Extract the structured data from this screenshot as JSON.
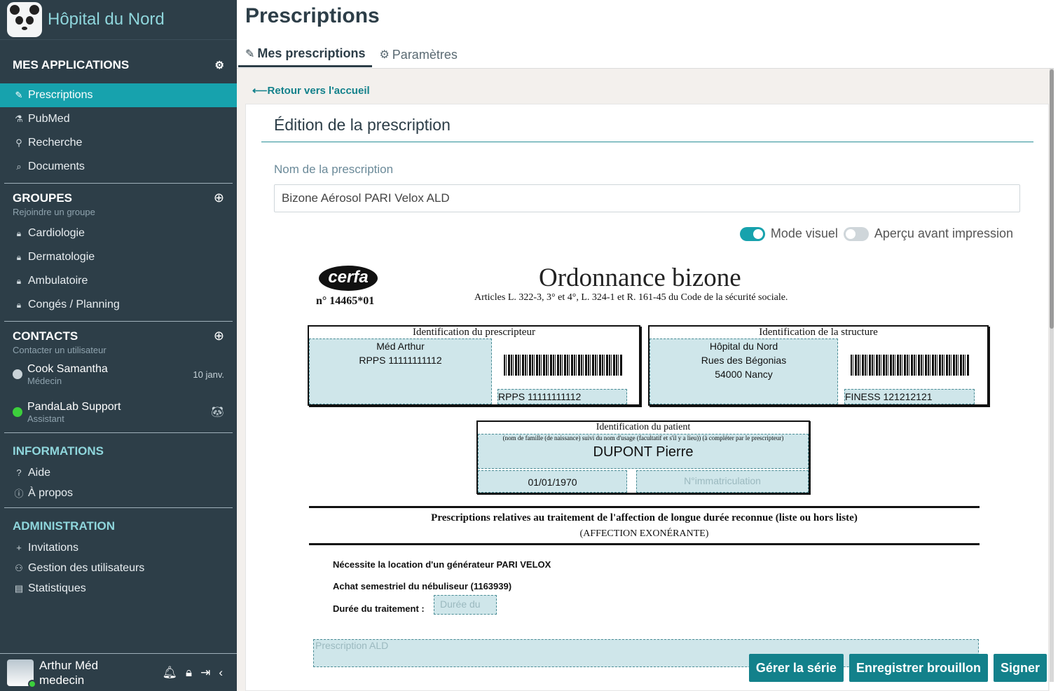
{
  "app": {
    "name": "Hôpital du Nord"
  },
  "sidebar": {
    "apps_header": "MES APPLICATIONS",
    "apps": [
      {
        "label": "Prescriptions",
        "icon": "prescription-icon",
        "glyph": "✎",
        "active": true
      },
      {
        "label": "PubMed",
        "icon": "pubmed-icon",
        "glyph": "⚗",
        "active": false
      },
      {
        "label": "Recherche",
        "icon": "search-icon",
        "glyph": "⚲",
        "active": false
      },
      {
        "label": "Documents",
        "icon": "paperclip-icon",
        "glyph": "⌕",
        "active": false
      }
    ],
    "groups_header": "GROUPES",
    "groups_sub": "Rejoindre un groupe",
    "groups": [
      {
        "label": "Cardiologie"
      },
      {
        "label": "Dermatologie"
      },
      {
        "label": "Ambulatoire"
      },
      {
        "label": "Congés / Planning"
      }
    ],
    "contacts_header": "CONTACTS",
    "contacts_sub": "Contacter un utilisateur",
    "contacts": [
      {
        "name": "Cook Samantha",
        "role": "Médecin",
        "meta": "10 janv.",
        "status_color": "#c9d3d8"
      },
      {
        "name": "PandaLab Support",
        "role": "Assistant",
        "meta": "",
        "status_color": "#3ccf3c"
      }
    ],
    "info_header": "INFORMATIONS",
    "info": [
      {
        "label": "Aide",
        "glyph": "?"
      },
      {
        "label": "À propos",
        "glyph": "ⓘ"
      }
    ],
    "admin_header": "ADMINISTRATION",
    "admin": [
      {
        "label": "Invitations",
        "glyph": "+"
      },
      {
        "label": "Gestion des utilisateurs",
        "glyph": "⚇"
      },
      {
        "label": "Statistiques",
        "glyph": "▤"
      }
    ],
    "user": {
      "name": "Arthur Méd",
      "role": "medecin"
    }
  },
  "main": {
    "title": "Prescriptions",
    "tabs": [
      {
        "label": "Mes prescriptions",
        "active": true
      },
      {
        "label": "Paramètres",
        "active": false
      }
    ],
    "back_label": "Retour vers l'accueil",
    "card_title": "Édition de la prescription",
    "name_label": "Nom de la prescription",
    "name_value": "Bizone Aérosol PARI Velox ALD",
    "toggle_visual": "Mode visuel",
    "toggle_preview": "Aperçu avant impression",
    "buttons": {
      "serie": "Gérer la série",
      "draft": "Enregistrer brouillon",
      "sign": "Signer"
    }
  },
  "document": {
    "cerfa_logo": "cerfa",
    "cerfa_num": "n° 14465*01",
    "title": "Ordonnance bizone",
    "subtitle": "Articles L. 322-3, 3° et 4°, L. 324-1 et R. 161-45 du Code de la sécurité sociale.",
    "prescriber_header": "Identification du prescripteur",
    "prescriber_name": "Méd Arthur",
    "prescriber_rpps": "RPPS 11111111112",
    "prescriber_rpps_code": "RPPS 11111111112",
    "structure_header": "Identification de la structure",
    "structure_name": "Hôpital du Nord",
    "structure_street": "Rues des Bégonias",
    "structure_city": "54000 Nancy",
    "structure_finess": "FINESS 121212121",
    "patient_header": "Identification  du patient",
    "patient_note": "(nom de famille (de naissance) suivi du nom d'usage (facultatif et s'il y a lieu)) (à compléter par le prescripteur)",
    "patient_name": "DUPONT Pierre",
    "patient_dob": "01/01/1970",
    "patient_immat_placeholder": "N°immatriculation",
    "section_title": "Prescriptions relatives au traitement de l'affection de longue durée reconnue (liste ou hors liste)",
    "section_sub": "(AFFECTION EXONÉRANTE)",
    "line1": "Nécessite la location d'un générateur PARI VELOX",
    "line2": "Achat semestriel du nébuliseur (1163939)",
    "line3": "Durée du traitement :",
    "duration_placeholder": "Durée du",
    "ald_placeholder": "Prescription ALD"
  }
}
